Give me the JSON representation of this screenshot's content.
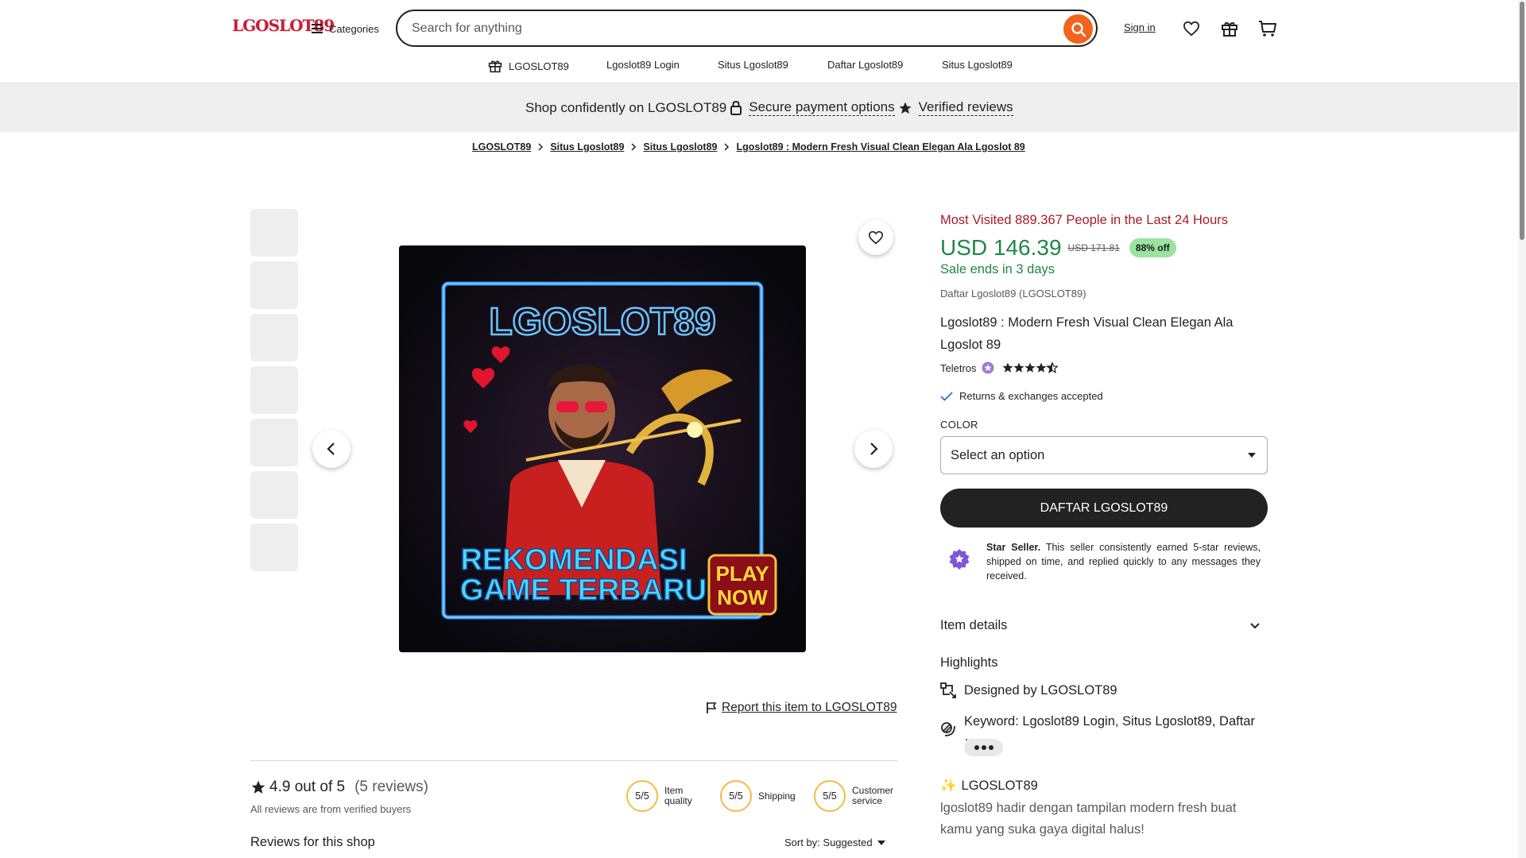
{
  "header": {
    "logo_text": "LGOSLOT89",
    "categories_label": "Categories",
    "search_placeholder": "Search for anything",
    "signin_label": "Sign in",
    "icons": [
      "menu-icon",
      "search-icon",
      "heart-icon",
      "gift-icon",
      "cart-icon"
    ]
  },
  "nav": {
    "items": [
      {
        "label": "LGOSLOT89",
        "icon": "gift-icon"
      },
      {
        "label": "Lgoslot89 Login"
      },
      {
        "label": "Situs Lgoslot89"
      },
      {
        "label": "Daftar Lgoslot89"
      },
      {
        "label": "Situs Lgoslot89"
      }
    ]
  },
  "trust_bar": {
    "text": "Shop confidently on LGOSLOT89",
    "secure": "Secure payment options",
    "verified": "Verified reviews"
  },
  "breadcrumb": [
    "LGOSLOT89",
    "Situs Lgoslot89",
    "Situs Lgoslot89",
    "Lgoslot89 : Modern Fresh Visual Clean Elegan Ala Lgoslot 89"
  ],
  "gallery": {
    "thumb_count": 7,
    "image_text": {
      "brand": "LGOSLOT89",
      "line1": "REKOMENDASI",
      "line2": "GAME TERBARU",
      "badge1": "PLAY",
      "badge2": "NOW"
    }
  },
  "report_label": "Report this item to LGOSLOT89",
  "reviews": {
    "rating": "4.9 out of 5",
    "count": "(5 reviews)",
    "verified_note": "All reviews are from verified buyers",
    "scores": [
      {
        "value": "5/5",
        "label": "Item quality"
      },
      {
        "value": "5/5",
        "label": "Shipping"
      },
      {
        "value": "5/5",
        "label": "Customer service"
      }
    ],
    "section_title": "Reviews for this shop",
    "sort_label": "Sort by: Suggested"
  },
  "product": {
    "most_visited": "Most Visited 889.367 People in the Last 24 Hours",
    "price": "USD 146.39",
    "old_price": "USD 171.81",
    "discount": "88% off",
    "sale_ends": "Sale ends in 3 days",
    "shop_sub": "Daftar Lgoslot89 (LGOSLOT89)",
    "title": "Lgoslot89 : Modern Fresh Visual Clean Elegan Ala Lgoslot 89",
    "seller": "Teletros",
    "seller_rating_stars": 4.5,
    "returns": "Returns & exchanges accepted",
    "color_label": "COLOR",
    "select_placeholder": "Select an option",
    "cta": "DAFTAR LGOSLOT89",
    "star_seller_bold": "Star Seller.",
    "star_seller_text": "This seller consistently earned 5-star reviews, shipped on time, and replied quickly to any messages they received.",
    "item_details": "Item details",
    "highlights_title": "Highlights",
    "highlights": [
      {
        "label": "Designed by LGOSLOT89",
        "icon": "designer-icon"
      },
      {
        "label": "Keyword: Lgoslot89 Login, Situs Lgoslot89, Daftar …",
        "icon": "layers-icon"
      }
    ],
    "desc_title": "LGOSLOT89",
    "desc_emoji": "✨",
    "desc": "lgoslot89 hadir dengan tampilan modern fresh buat kamu yang suka gaya digital halus!"
  },
  "colors": {
    "accent_orange": "#f1641e",
    "price_green": "#1f8749",
    "alert_red": "#a61a2e",
    "discount_bg": "#9be39f",
    "star_seller_purple": "#7f58d6"
  }
}
